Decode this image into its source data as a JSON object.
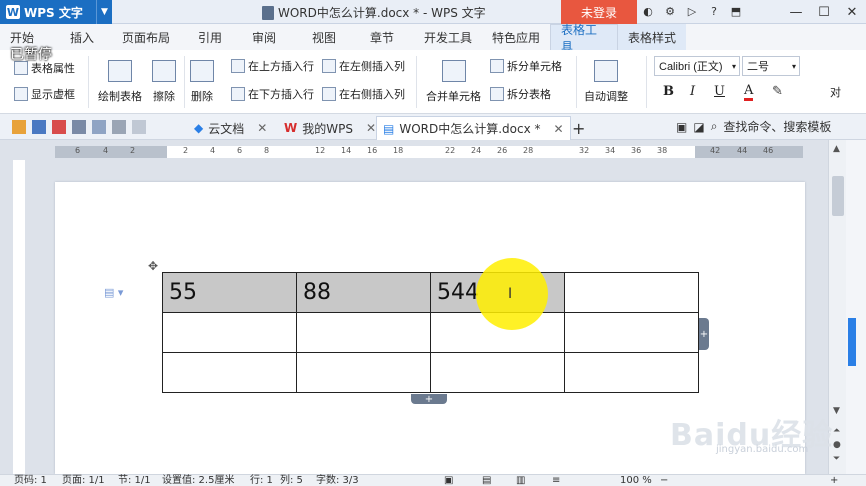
{
  "app": {
    "menu_button": "WPS 文字",
    "window_title": "WORD中怎么计算.docx * - WPS 文字",
    "login": "未登录",
    "paused_overlay": "已暂停"
  },
  "menu_tabs": [
    "开始",
    "插入",
    "页面布局",
    "引用",
    "审阅",
    "视图",
    "章节",
    "开发工具",
    "特色应用",
    "表格工具",
    "表格样式"
  ],
  "ribbon": {
    "table_props": "表格属性",
    "show_gridlines": "显示虚框",
    "draw_table": "绘制表格",
    "erase": "擦除",
    "delete": "删除",
    "insert_above": "在上方插入行",
    "insert_below": "在下方插入行",
    "insert_left": "在左侧插入列",
    "insert_right": "在右侧插入列",
    "merge_cells": "合并单元格",
    "split_cells": "拆分单元格",
    "split_table": "拆分表格",
    "auto_fit": "自动调整",
    "font_name": "Calibri (正文)",
    "font_size": "二号",
    "bold": "B",
    "italic": "I",
    "underline": "U",
    "font_color": "A",
    "align_partial": "对"
  },
  "doc_tabs": {
    "cloud": "云文档",
    "mywps": "我的WPS",
    "current": "WORD中怎么计算.docx *",
    "new_tab": "+"
  },
  "search": {
    "placeholder": "查找命令、搜索模板"
  },
  "ruler_numbers": [
    "6",
    "4",
    "2",
    "2",
    "4",
    "6",
    "8",
    "12",
    "14",
    "16",
    "18",
    "22",
    "24",
    "26",
    "28",
    "32",
    "34",
    "36",
    "38",
    "42",
    "44",
    "46"
  ],
  "table": {
    "rows": [
      [
        "55",
        "88",
        "544",
        ""
      ],
      [
        "",
        "",
        "",
        ""
      ],
      [
        "",
        "",
        "",
        ""
      ]
    ]
  },
  "watermark": {
    "brand": "Baidu经验",
    "url": "jingyan.baidu.com"
  },
  "status": {
    "page": "页码: 1",
    "pages": "页面: 1/1",
    "section": "节: 1/1",
    "setting": "设置值: 2.5厘米",
    "row": "行: 1",
    "col": "列: 5",
    "words": "字数: 3/3",
    "zoom": "100 %"
  }
}
